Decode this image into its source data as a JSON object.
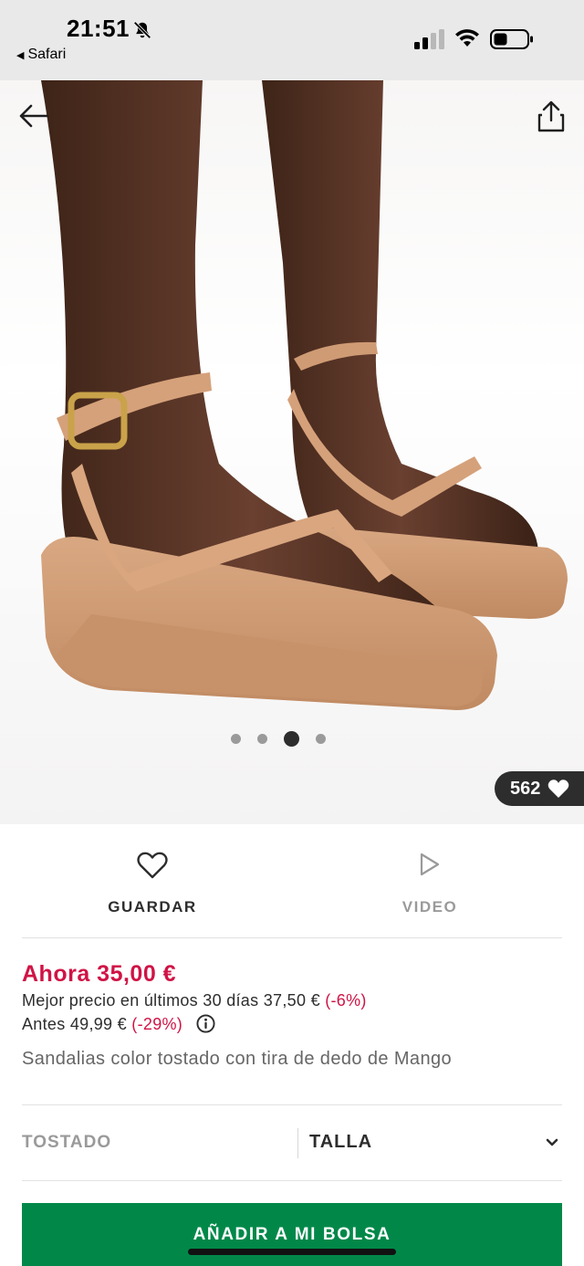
{
  "status_bar": {
    "time": "21:51",
    "back_app": "Safari",
    "icons": [
      "bell-slash-icon",
      "cellular-signal-icon",
      "wifi-icon",
      "battery-icon"
    ]
  },
  "hero": {
    "image_alt": "Sandalias color tostado con tira de dedo",
    "icons": {
      "back": "arrow-left-icon",
      "share": "share-icon"
    },
    "carousel": {
      "count": 4,
      "active_index": 2
    },
    "likes": "562"
  },
  "actions": {
    "save_label": "GUARDAR",
    "video_label": "VIDEO"
  },
  "pricing": {
    "current": "Ahora 35,00 €",
    "best_label": "Mejor precio en últimos 30 días 37,50 € ",
    "best_discount": "(-6%)",
    "before_label": "Antes 49,99 € ",
    "before_discount": "(-29%)"
  },
  "product": {
    "name": "Sandalias color tostado con tira de dedo de Mango"
  },
  "variant": {
    "colour": "TOSTADO",
    "size_label": "TALLA"
  },
  "cta": {
    "add_to_bag": "AÑADIR A MI BOLSA"
  },
  "colors": {
    "accent_red": "#d01345",
    "cta_green": "#018849",
    "text_dark": "#2d2d2d",
    "muted": "#9a9a9a"
  }
}
